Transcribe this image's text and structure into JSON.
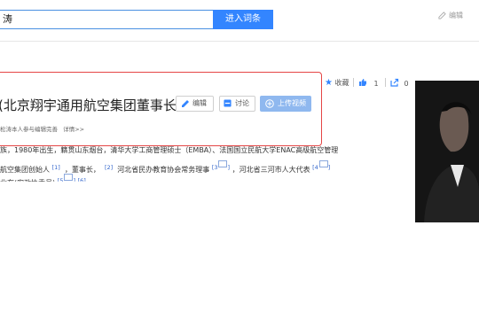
{
  "search": {
    "value": "涛"
  },
  "header": {
    "enter_label": "进入词条",
    "edit_label": "编辑"
  },
  "entry": {
    "title": "北京翔宇通用航空集团董事长)",
    "buttons": {
      "edit": "编辑",
      "discuss": "讨论",
      "upload": "上传视频"
    },
    "byline": "松涛本人参与编辑完善",
    "detail_link": "详情>>"
  },
  "actions": {
    "collect": "收藏",
    "like_count": "1",
    "share_count": "0"
  },
  "bio": {
    "line1": "族，1980年出生，籍贯山东烟台，清华大学工商管理硕士（EMBA）、法国国立民航大学ENAC高级航空管理",
    "line2_a": "航空集团创始人",
    "ref1": "[1]",
    "line2_b": "，董事长，",
    "ref2": "[2]",
    "line2_c": "河北省民办教育协会常务理事",
    "ref3": "[3",
    "line2_d": "，河北省三河市人大代表",
    "ref4": "[4",
    "line3": "北在(安政协委员)",
    "ref5": "[5",
    "ref6": "[6]"
  },
  "colors": {
    "accent": "#3385ff",
    "highlight_border": "#e54646",
    "upload_button": "#8fb8ef"
  }
}
